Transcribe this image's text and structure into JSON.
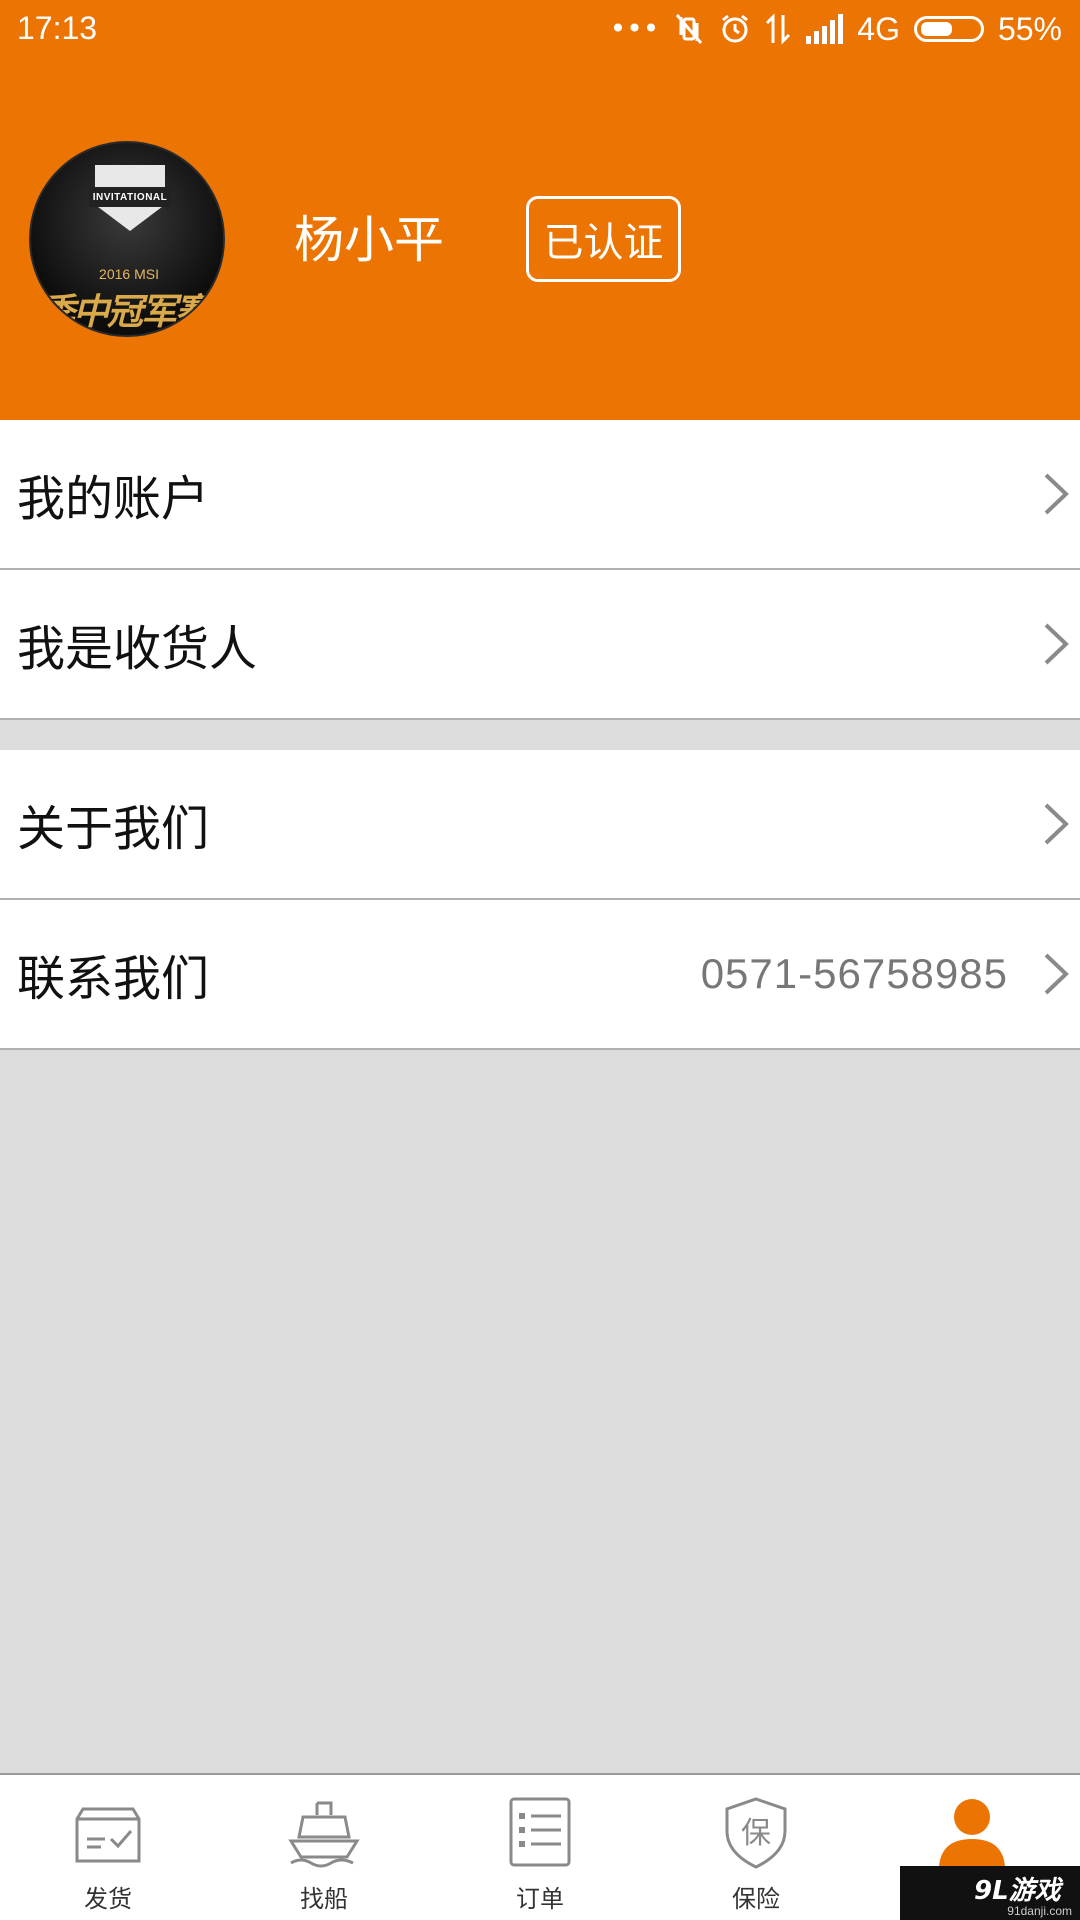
{
  "status_bar": {
    "time": "17:13",
    "network": "4G",
    "battery_percent": "55%",
    "battery_level": 0.55,
    "icons": [
      "more-dots-icon",
      "vibrate-off-icon",
      "alarm-icon",
      "data-arrows-icon",
      "signal-icon",
      "battery-icon"
    ]
  },
  "profile": {
    "name": "杨小平",
    "verified_label": "已认证",
    "avatar": {
      "banner_text": "INVITATIONAL",
      "year_text": "2016 MSI",
      "slogan": "季中冠军赛"
    }
  },
  "menu": {
    "group1": [
      {
        "label": "我的账户"
      },
      {
        "label": "我是收货人"
      }
    ],
    "group2": [
      {
        "label": "关于我们"
      },
      {
        "label": "联系我们",
        "value": "0571-56758985"
      }
    ]
  },
  "tabbar": {
    "tabs": [
      {
        "label": "发货",
        "icon": "shipping-box-icon"
      },
      {
        "label": "找船",
        "icon": "ship-icon"
      },
      {
        "label": "订单",
        "icon": "order-list-icon"
      },
      {
        "label": "保险",
        "icon": "insurance-shield-icon"
      },
      {
        "label": "",
        "icon": "user-icon",
        "active": true
      }
    ]
  },
  "watermark": {
    "brand": "9L游戏",
    "url": "91danji.com"
  },
  "colors": {
    "accent": "#ec7403",
    "background": "#dcdcdc",
    "divider": "#b0b0b0",
    "tab_icon": "#8a8a8a"
  }
}
